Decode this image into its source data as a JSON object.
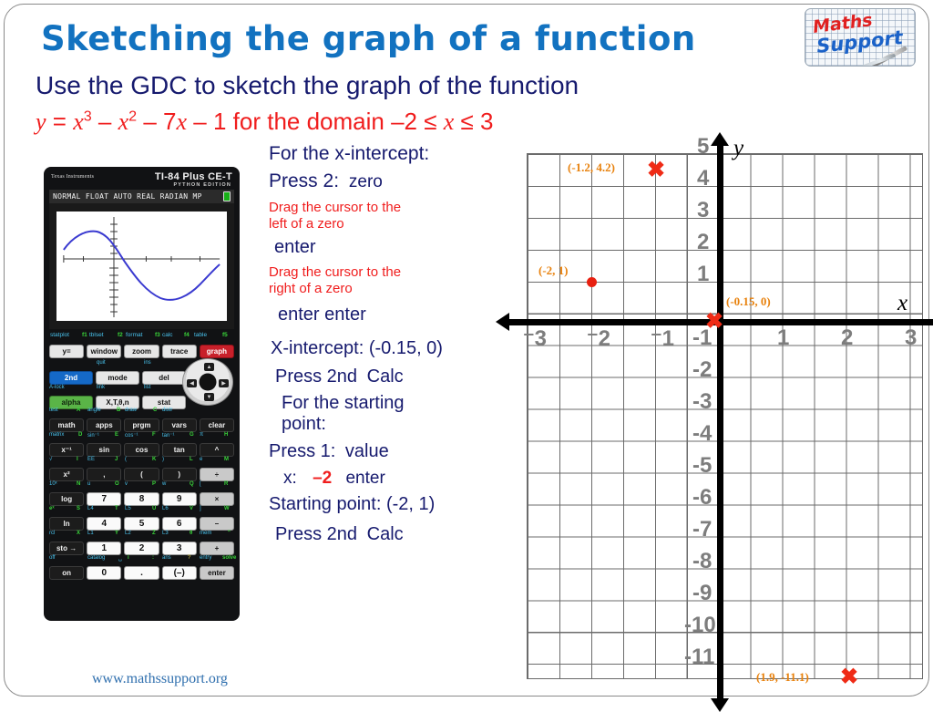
{
  "header": {
    "title": "Sketching the graph of a function",
    "subtitle": "Use the GDC to sketch the graph of the function",
    "equation_plain": "y = x3 – x2 – 7x – 1 for the domain –2 ≤ x ≤ 3"
  },
  "logo": {
    "word1": "Maths",
    "word2": "Support"
  },
  "calculator": {
    "brand": "Texas Instruments",
    "model": "TI-84 Plus CE-T",
    "edition": "PYTHON EDITION",
    "status_line": "NORMAL FLOAT AUTO REAL RADIAN MP",
    "fkey_labels": [
      "statplot",
      "f1",
      "tblset",
      "f2",
      "format",
      "f3",
      "calc",
      "f4",
      "table",
      "f5"
    ],
    "fkeys": [
      "y=",
      "window",
      "zoom",
      "trace",
      "graph"
    ],
    "row_quit_ins": [
      "quit",
      "ins"
    ],
    "row1": [
      "2nd",
      "mode",
      "del"
    ],
    "row_alock": [
      "A-lock",
      "link",
      "list"
    ],
    "row2": [
      "alpha",
      "X,T,θ,n",
      "stat"
    ],
    "row_test": [
      "test",
      "A",
      "angle",
      "B",
      "draw",
      "C",
      "distr"
    ],
    "row3": [
      "math",
      "apps",
      "prgm",
      "vars",
      "clear"
    ],
    "row_matrix": [
      "matrix",
      "D",
      "sin⁻¹",
      "E",
      "cos⁻¹",
      "F",
      "tan⁻¹",
      "G",
      "π",
      "H"
    ],
    "row4": [
      "x⁻¹",
      "sin",
      "cos",
      "tan",
      "^"
    ],
    "row_sqrt": [
      "√",
      "I",
      "EE",
      "J",
      "(",
      "K",
      ")",
      "L",
      "e",
      "M"
    ],
    "row5": [
      "x²",
      ",",
      "(",
      ")",
      "÷"
    ],
    "row_10x": [
      "10ˣ",
      "N",
      "u",
      "O",
      "v",
      "P",
      "w",
      "Q",
      "[",
      "R"
    ],
    "row6": [
      "log",
      "7",
      "8",
      "9",
      "×"
    ],
    "row_ex": [
      "eˣ",
      "S",
      "L4",
      "T",
      "L5",
      "U",
      "L6",
      "V",
      "]",
      "W"
    ],
    "row7": [
      "ln",
      "4",
      "5",
      "6",
      "–"
    ],
    "row_rcl": [
      "rcl",
      "X",
      "L1",
      "Y",
      "L2",
      "Z",
      "L3",
      "θ",
      "mem",
      "\""
    ],
    "row8": [
      "sto →",
      "1",
      "2",
      "3",
      "+"
    ],
    "row_off": [
      "off",
      "catalog",
      "␣",
      "i",
      ":",
      "ans",
      "?",
      "entry",
      "solve"
    ],
    "row9": [
      "on",
      "0",
      ".",
      "(–)",
      "enter"
    ]
  },
  "instructions": [
    {
      "text": "For the x-intercept:",
      "color": "navy",
      "size": 21
    },
    {
      "text": "Press 2:",
      "second": "zero",
      "color": "navy",
      "size": 21
    },
    {
      "text": "Drag the cursor to the",
      "color": "red",
      "size": 15
    },
    {
      "text": "left of a zero",
      "color": "red",
      "size": 15
    },
    {
      "text": "enter",
      "color": "navy",
      "size": 20
    },
    {
      "text": "Drag the cursor to the",
      "color": "red",
      "size": 15
    },
    {
      "text": "right of a zero",
      "color": "red",
      "size": 15
    },
    {
      "text": "enter   enter",
      "color": "navy",
      "size": 20
    },
    {
      "text": "X-intercept: (-0.15, 0)",
      "color": "navy",
      "size": 20
    },
    {
      "text": "Press 2nd",
      "second": "Calc",
      "color": "navy",
      "size": 20
    },
    {
      "text": "For the starting",
      "color": "navy",
      "size": 20
    },
    {
      "text": "point:",
      "color": "navy",
      "size": 20
    },
    {
      "text": "Press 1:",
      "second": "value",
      "color": "navy",
      "size": 20
    },
    {
      "text": "x:",
      "red_mid": "–2",
      "second": "enter",
      "color": "navy",
      "size": 19
    },
    {
      "text": "Starting point: (-2, 1)",
      "color": "navy",
      "size": 20
    },
    {
      "text": "Press 2nd",
      "second": "Calc",
      "color": "navy",
      "size": 20
    }
  ],
  "footer": {
    "url": "www.mathssupport.org"
  },
  "chart_data": {
    "type": "scatter",
    "title": "",
    "xlabel": "x",
    "ylabel": "y",
    "xlim": [
      -3,
      3
    ],
    "ylim": [
      -11.5,
      5
    ],
    "xticks": [
      "⁻3",
      "⁻2",
      "⁻1",
      "1",
      "2",
      "3"
    ],
    "xtick_values": [
      -3,
      -2,
      -1,
      1,
      2,
      3
    ],
    "yticks": [
      "5",
      "4",
      "3",
      "2",
      "1",
      "-1",
      "-2",
      "-3",
      "-4",
      "-5",
      "-6",
      "-7",
      "-8",
      "-9",
      "-10",
      "-11"
    ],
    "ytick_values": [
      5,
      4,
      3,
      2,
      1,
      -1,
      -2,
      -3,
      -4,
      -5,
      -6,
      -7,
      -8,
      -9,
      -10,
      -11
    ],
    "grid": true,
    "legend": "none",
    "points": [
      {
        "label": "(-1.2, 4.2)",
        "x": -1.2,
        "y": 4.2,
        "marker": "x",
        "color": "#ef2b16"
      },
      {
        "label": "(-2, 1)",
        "x": -2.0,
        "y": 1.0,
        "marker": "dot",
        "color": "#e82010"
      },
      {
        "label": "(-0.15, 0)",
        "x": -0.15,
        "y": 0.0,
        "marker": "x",
        "color": "#ef2b16"
      },
      {
        "label": "(1.9, -11.1)",
        "x": 1.9,
        "y": -11.1,
        "marker": "x",
        "color": "#ef2b16"
      }
    ],
    "label_color": "#e8820e",
    "function": "y = x^3 - x^2 - 7x - 1",
    "domain": [
      -2,
      3
    ]
  },
  "colors": {
    "title_blue": "#1272c0",
    "navy": "#161a6e",
    "red": "#f01d1d",
    "orange": "#e8820e",
    "marker_red": "#ef2b16",
    "tick_grey": "#7d7d7d",
    "footer_blue": "#2f6fae"
  }
}
